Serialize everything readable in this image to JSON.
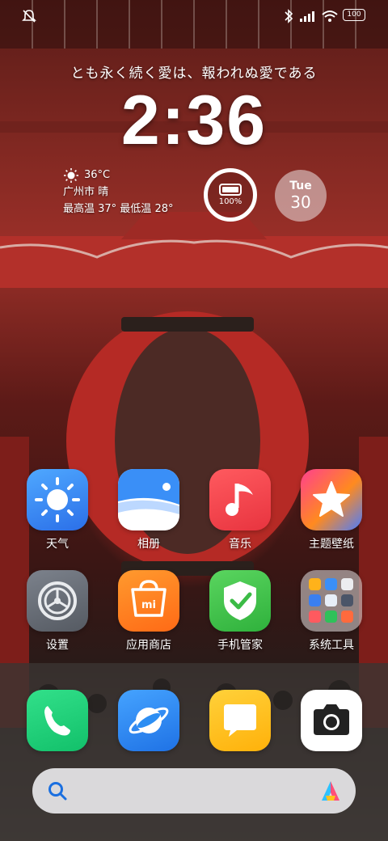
{
  "status_bar": {
    "left_icon": "notification-muted-icon",
    "right_icons": [
      "bluetooth-icon",
      "signal-icon",
      "wifi-icon",
      "battery-icon"
    ],
    "battery_level": "100"
  },
  "lockscreen_text": "とも永く続く愛は、報われぬ愛である",
  "clock": "2:36",
  "weather": {
    "temperature": "36°C",
    "city_condition": "广州市 晴",
    "high_low": "最高温 37°  最低温 28°"
  },
  "battery_widget": {
    "percent": "100%",
    "level": 1.0
  },
  "date_widget": {
    "weekday": "Tue",
    "day": "30"
  },
  "apps": [
    {
      "name": "weather",
      "label": "天气",
      "icon": "weather-sun-icon",
      "color": "#2f8bff"
    },
    {
      "name": "gallery",
      "label": "相册",
      "icon": "gallery-icon",
      "color": "#3a8ff7"
    },
    {
      "name": "music",
      "label": "音乐",
      "icon": "music-note-icon",
      "color": "#f0444e"
    },
    {
      "name": "themes",
      "label": "主题壁纸",
      "icon": "theme-star-icon",
      "color": "#ff6a3d"
    },
    {
      "name": "settings",
      "label": "设置",
      "icon": "settings-gear-icon",
      "color": "#6b7079"
    },
    {
      "name": "app-store",
      "label": "应用商店",
      "icon": "shopping-bag-icon",
      "color": "#ff7a22"
    },
    {
      "name": "security",
      "label": "手机管家",
      "icon": "shield-check-icon",
      "color": "#3fc04c"
    },
    {
      "name": "system-tools",
      "label": "系统工具",
      "icon": "folder-icon",
      "color": "#c8c4c4"
    }
  ],
  "dock": [
    {
      "name": "phone",
      "icon": "phone-icon",
      "color": "#1fcf77"
    },
    {
      "name": "browser",
      "icon": "browser-planet-icon",
      "color": "#2d8ef3"
    },
    {
      "name": "messages",
      "icon": "message-bubble-icon",
      "color": "#ffc21a"
    },
    {
      "name": "camera",
      "icon": "camera-icon",
      "color": "#ffffff"
    }
  ],
  "search_bar": {
    "search_icon": "search-icon",
    "assistant_icon": "xiaoai-icon"
  }
}
